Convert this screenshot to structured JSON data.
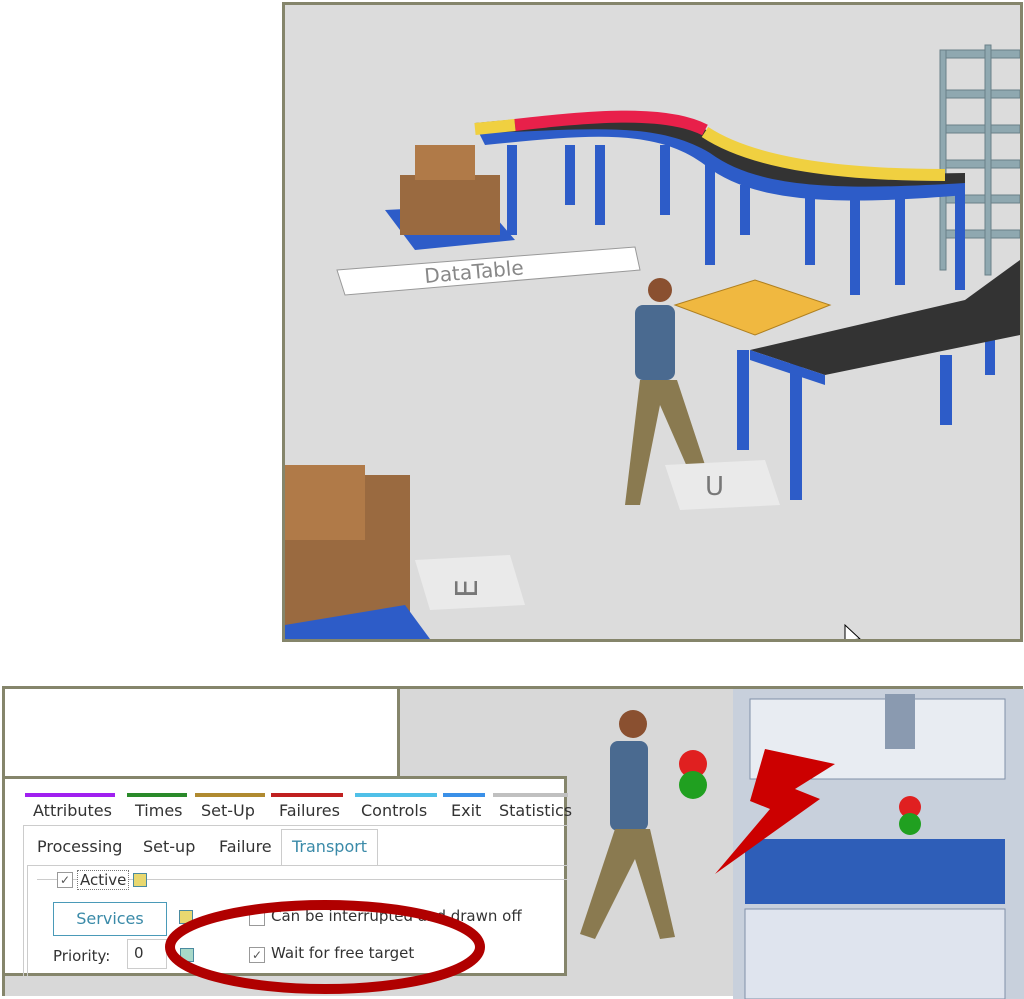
{
  "scene_top": {
    "datatable_label": "DataTable",
    "station_labels": [
      "U",
      "E"
    ]
  },
  "dialog": {
    "property_tabs": [
      {
        "label": "Attributes",
        "color": "#a020f0"
      },
      {
        "label": "Times",
        "color": "#2a8a2a"
      },
      {
        "label": "Set-Up",
        "color": "#b08a30"
      },
      {
        "label": "Failures",
        "color": "#c02020"
      },
      {
        "label": "Controls",
        "color": "#50c0e8"
      },
      {
        "label": "Exit",
        "color": "#3a90e8"
      },
      {
        "label": "Statistics",
        "color": "#c0c0c0"
      }
    ],
    "sub_tabs": [
      "Processing",
      "Set-up",
      "Failure",
      "Transport"
    ],
    "active_sub_tab": "Transport",
    "active_label": "Active",
    "active_checked": true,
    "services_button": "Services",
    "priority_label": "Priority:",
    "priority_value": "0",
    "interrupt_label": "Can be interrupted and drawn off",
    "interrupt_checked": false,
    "wait_label": "Wait for free target",
    "wait_checked": true,
    "highlight_color": "#b00000"
  }
}
